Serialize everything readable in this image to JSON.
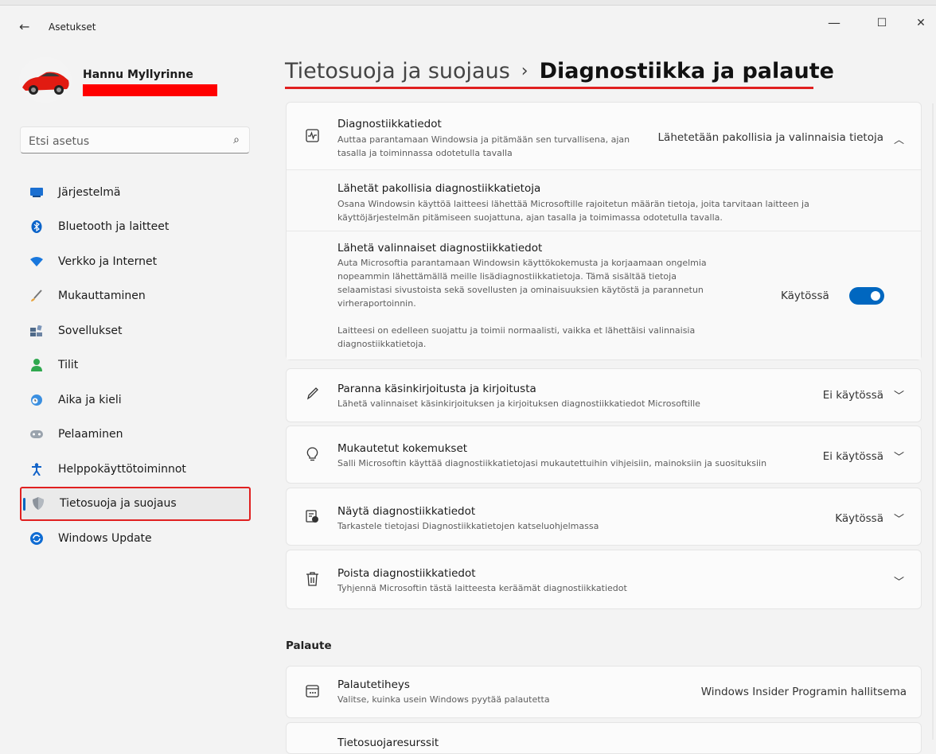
{
  "window": {
    "title": "Asetukset",
    "minimize": "—",
    "maximize": "☐",
    "close": "✕"
  },
  "user": {
    "name": "Hannu Myllyrinne"
  },
  "search": {
    "placeholder": "Etsi asetus"
  },
  "sidebar": {
    "items": [
      {
        "label": "Järjestelmä",
        "icon": "system-icon"
      },
      {
        "label": "Bluetooth ja laitteet",
        "icon": "bluetooth-icon"
      },
      {
        "label": "Verkko ja Internet",
        "icon": "wifi-icon"
      },
      {
        "label": "Mukauttaminen",
        "icon": "brush-icon"
      },
      {
        "label": "Sovellukset",
        "icon": "apps-icon"
      },
      {
        "label": "Tilit",
        "icon": "account-icon"
      },
      {
        "label": "Aika ja kieli",
        "icon": "time-language-icon"
      },
      {
        "label": "Pelaaminen",
        "icon": "gamepad-icon"
      },
      {
        "label": "Helppokäyttötoiminnot",
        "icon": "accessibility-icon"
      },
      {
        "label": "Tietosuoja ja suojaus",
        "icon": "shield-icon",
        "active": true
      },
      {
        "label": "Windows Update",
        "icon": "windows-update-icon"
      }
    ]
  },
  "header": {
    "parent": "Tietosuoja ja suojaus",
    "separator": "›",
    "current": "Diagnostiikka ja palaute"
  },
  "diagnostics": {
    "title": "Diagnostiikkatiedot",
    "sub1": "Auttaa parantamaan Windowsia ja pitämään sen turvallisena, ajan",
    "sub2": "tasalla ja toiminnassa odotetulla tavalla",
    "state": "Lähetetään pakollisia ja valinnaisia tietoja",
    "required": {
      "title": "Lähetät pakollisia diagnostiikkatietoja",
      "sub1": "Osana Windowsin käyttöä laitteesi lähettää Microsoftille rajoitetun määrän tietoja, joita tarvitaan laitteen ja",
      "sub2": "käyttöjärjestelmän pitämiseen suojattuna, ajan tasalla ja toimimassa odotetulla tavalla."
    },
    "optional": {
      "title": "Lähetä valinnaiset diagnostiikkatiedot",
      "sub1": "Auta Microsoftia parantamaan Windowsin käyttökokemusta ja korjaamaan ongelmia",
      "sub2": "nopeammin lähettämällä meille lisädiagnostiikkatietoja. Tämä sisältää tietoja",
      "sub3": "selaamistasi sivustoista sekä sovellusten ja ominaisuuksien käytöstä ja parannetun",
      "sub4": "virheraportoinnin.",
      "sub5": "Laitteesi on edelleen suojattu ja toimii normaalisti, vaikka et lähettäisi valinnaisia",
      "sub6": "diagnostiikkatietoja.",
      "toggle_label": "Käytössä",
      "toggle_on": true
    }
  },
  "handwriting": {
    "title": "Paranna käsinkirjoitusta ja kirjoitusta",
    "sub": "Lähetä valinnaiset käsinkirjoituksen ja kirjoituksen diagnostiikkatiedot Microsoftille",
    "state": "Ei käytössä"
  },
  "tailored": {
    "title": "Mukautetut kokemukset",
    "sub": "Salli Microsoftin käyttää diagnostiikkatietojasi mukautettuihin vihjeisiin, mainoksiin ja suosituksiin",
    "state": "Ei käytössä"
  },
  "viewer": {
    "title": "Näytä diagnostiikkatiedot",
    "sub": "Tarkastele tietojasi Diagnostiikkatietojen katseluohjelmassa",
    "state": "Käytössä"
  },
  "delete": {
    "title": "Poista diagnostiikkatiedot",
    "sub": "Tyhjennä Microsoftin tästä laitteesta keräämät diagnostiikkatiedot"
  },
  "feedback": {
    "section": "Palaute",
    "frequency": {
      "title": "Palautetiheys",
      "sub": "Valitse, kuinka usein Windows pyytää palautetta",
      "state": "Windows Insider Programin hallitsema"
    },
    "privacy": {
      "title": "Tietosuojaresurssit"
    }
  }
}
